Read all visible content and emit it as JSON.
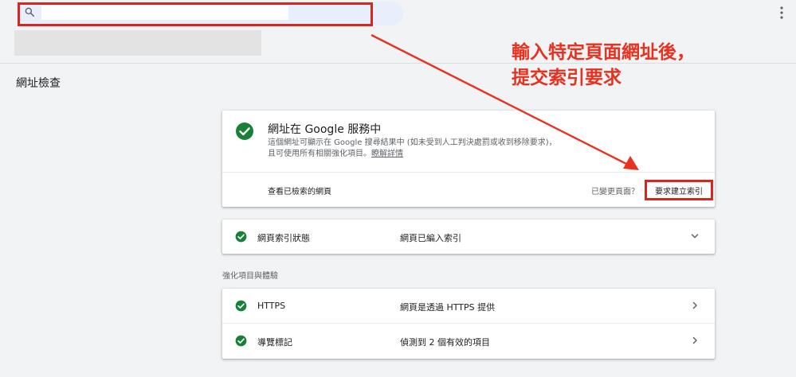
{
  "search": {
    "value": "",
    "placeholder": ""
  },
  "page": {
    "title": "網址檢查"
  },
  "annotation": {
    "line1": "輸入特定頁面網址後，",
    "line2": "提交索引要求"
  },
  "status_card": {
    "title": "網址在 Google 服務中",
    "desc_line1": "這個網址可顯示在 Google 搜尋結果中 (如未受到人工判決處罰或收到移除要求)，",
    "desc_line2": "且可使用所有相關強化項目。",
    "learn_more": "瞭解詳情",
    "view_crawled": "查看已檢索的網頁",
    "changed_prompt": "已變更頁面？",
    "request_indexing": "要求建立索引"
  },
  "index_row": {
    "label": "網頁索引狀態",
    "value": "網頁已編入索引"
  },
  "enhancements": {
    "section_label": "強化項目與體驗",
    "rows": [
      {
        "label": "HTTPS",
        "value": "網頁是透過 HTTPS 提供"
      },
      {
        "label": "導覽標記",
        "value": "偵測到 2 個有效的項目"
      }
    ]
  },
  "colors": {
    "accent_red": "#d8261c",
    "success_green": "#188038",
    "search_bg": "#e8eefc"
  },
  "icons": [
    "search-icon",
    "check-circle-icon",
    "chevron-down-icon",
    "chevron-right-icon",
    "more-vert-icon",
    "arrow-icon"
  ]
}
